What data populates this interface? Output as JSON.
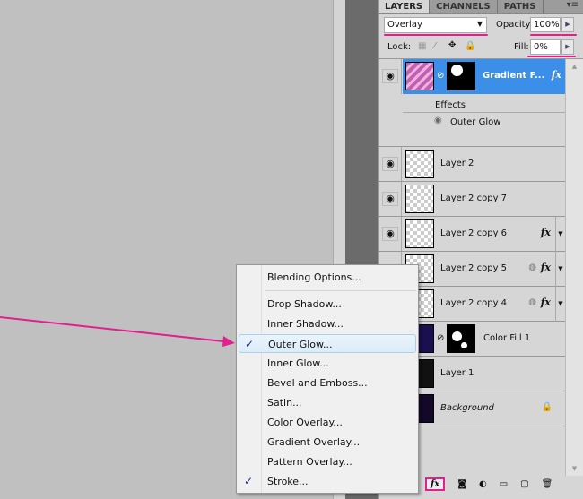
{
  "tabs": [
    "LAYERS",
    "CHANNELS",
    "PATHS"
  ],
  "blend_mode": "Overlay",
  "opacity_label": "Opacity:",
  "opacity": "100%",
  "lock_label": "Lock:",
  "fill_label": "Fill:",
  "fill": "0%",
  "layers": [
    {
      "name": "Gradient F...",
      "selected": true,
      "fx": "fx"
    },
    {
      "name": "Layer 2"
    },
    {
      "name": "Layer 2 copy 7"
    },
    {
      "name": "Layer 2 copy 6",
      "fx": "fx"
    },
    {
      "name": "Layer 2 copy 5",
      "fx": "fx"
    },
    {
      "name": "Layer 2 copy 4",
      "fx": "fx"
    },
    {
      "name": "Color Fill 1"
    },
    {
      "name": "Layer 1"
    },
    {
      "name": "Background"
    }
  ],
  "effects_label": "Effects",
  "effect_item": "Outer Glow",
  "bottom_fx": "fx",
  "menu": [
    "Blending Options...",
    "Drop Shadow...",
    "Inner Shadow...",
    "Outer Glow...",
    "Inner Glow...",
    "Bevel and Emboss...",
    "Satin...",
    "Color Overlay...",
    "Gradient Overlay...",
    "Pattern Overlay...",
    "Stroke..."
  ],
  "accent": "#e0208f"
}
